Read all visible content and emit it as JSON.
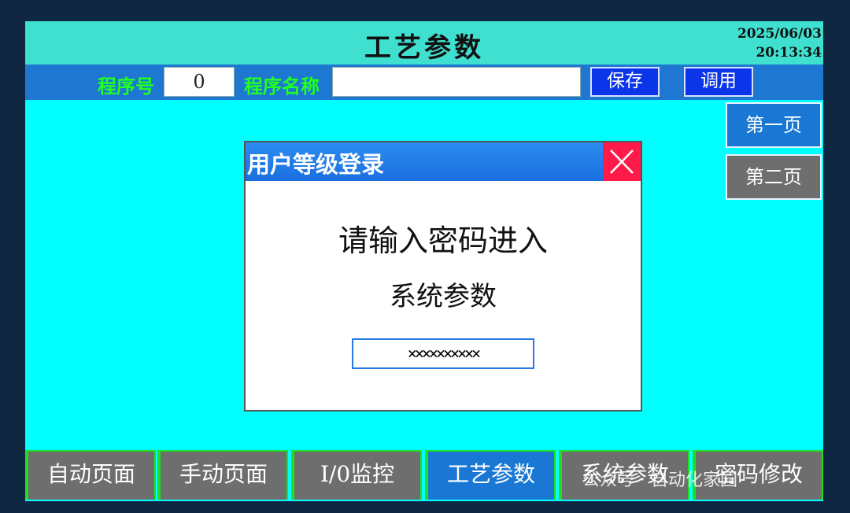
{
  "header": {
    "title": "工艺参数",
    "date": "2025/06/03",
    "time": "20:13:34"
  },
  "program_bar": {
    "number_label": "程序号",
    "number_value": "0",
    "name_label": "程序名称",
    "name_value": "",
    "save_label": "保存",
    "load_label": "调用"
  },
  "pages": {
    "page1": "第一页",
    "page2": "第二页"
  },
  "dialog": {
    "title": "用户等级登录",
    "message": "请输入密码进入",
    "subtitle": "系统参数",
    "password_mask": "××××××××××"
  },
  "nav": [
    {
      "label": "自动页面"
    },
    {
      "label": "手动页面"
    },
    {
      "label": "I/0监控"
    },
    {
      "label": "工艺参数"
    },
    {
      "label": "系统参数"
    },
    {
      "label": "密码修改"
    }
  ],
  "watermark": "公众号 · 自动化家园",
  "colors": {
    "screen_bg": "#00ffff",
    "title_bg": "#40e0d0",
    "bar_bg": "#1e78d2",
    "label_green": "#22ff22",
    "button_blue": "#0a35e8",
    "page_active": "#1a78d4",
    "page_inactive": "#6e6e6e",
    "close_red": "#ff1a4a"
  }
}
